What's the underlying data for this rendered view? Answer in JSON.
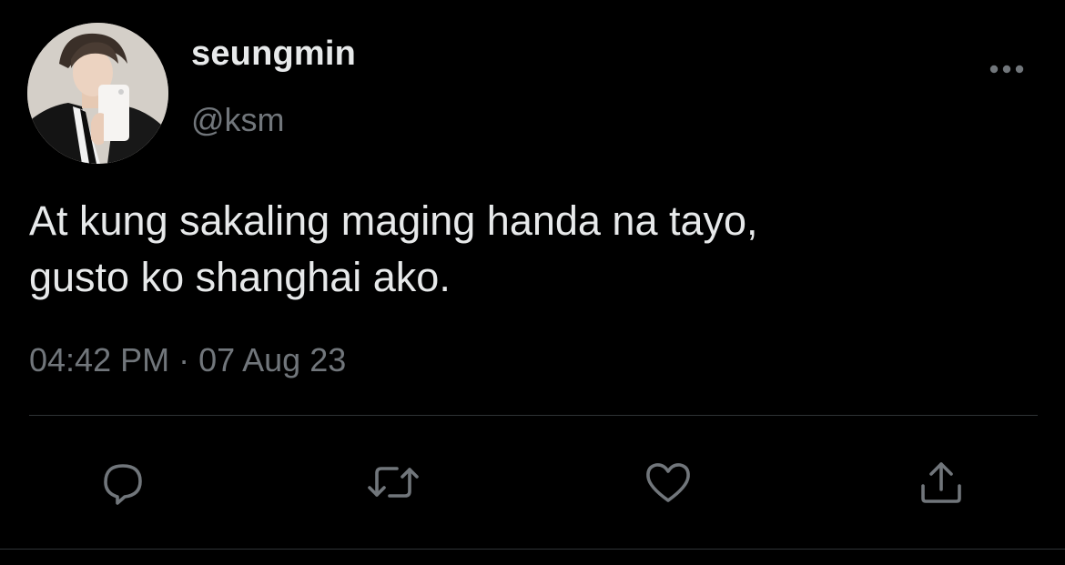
{
  "user": {
    "display_name": "seungmin",
    "handle": "@ksm"
  },
  "tweet": {
    "text": "At kung sakaling maging handa na tayo,\ngusto ko shanghai ako.",
    "time": "04:42 PM",
    "separator": "·",
    "date": "07 Aug 23"
  },
  "actions": [
    {
      "icon": "reply-icon"
    },
    {
      "icon": "retweet-icon"
    },
    {
      "icon": "like-icon"
    },
    {
      "icon": "share-icon"
    }
  ],
  "colors": {
    "background": "#000000",
    "primary_text": "#e7e9ea",
    "secondary_text": "#71767b",
    "icon": "#71767b",
    "divider": "#2f3336"
  }
}
